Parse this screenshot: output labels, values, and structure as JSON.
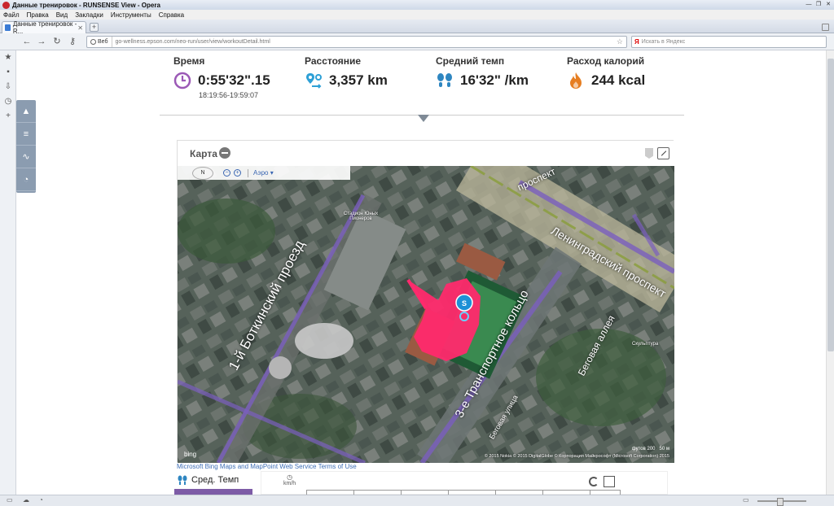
{
  "window": {
    "title": "Данные тренировок - RUNSENSE View - Opera",
    "menu": [
      "Файл",
      "Правка",
      "Вид",
      "Закладки",
      "Инструменты",
      "Справка"
    ],
    "tab_title": "Данные тренировок - R...",
    "web_chip": "Веб",
    "url": "go-wellness.epson.com/neo-run/user/view/workoutDetail.html",
    "search_placeholder": "Искать в Яндекс"
  },
  "stats": {
    "time": {
      "label": "Время",
      "value": "0:55'32\".15",
      "sub": "18:19:56-19:59:07",
      "color": "#9b59b6"
    },
    "distance": {
      "label": "Расстояние",
      "value": "3,357 km",
      "color": "#2ea0d6"
    },
    "pace": {
      "label": "Средний темп",
      "value": "16'32\" /km",
      "color": "#2e86c1"
    },
    "calories": {
      "label": "Расход калорий",
      "value": "244 kcal",
      "color": "#e67e22"
    }
  },
  "map": {
    "title": "Карта",
    "compass": "N",
    "aerial": "Аэро ▾",
    "labels": {
      "street1": "1-й Боткинский проезд",
      "street2": "Ленинградский проспект",
      "street3": "3-е Транспортное кольцо",
      "street4": "Беговая аллея",
      "street5": "Беговая улица",
      "street6": "проспект",
      "poi1": "Стадион Юных Пионеров",
      "poi2": "Скульптура"
    },
    "marker": "S",
    "scale": "футов 200",
    "scale2": "50 м",
    "copyright": "© 2015 Nokia  © 2015 DigitalGlobe  © Корпорация Майкрософт (Microsoft Corporation) 2015",
    "bing": "bing",
    "route_color": "#ff2a6d"
  },
  "terms_link": "Microsoft Bing Maps and MapPoint Web Service Terms of Use",
  "chart": {
    "metric_selected": "Сред. Темп",
    "unit": "km/h"
  }
}
